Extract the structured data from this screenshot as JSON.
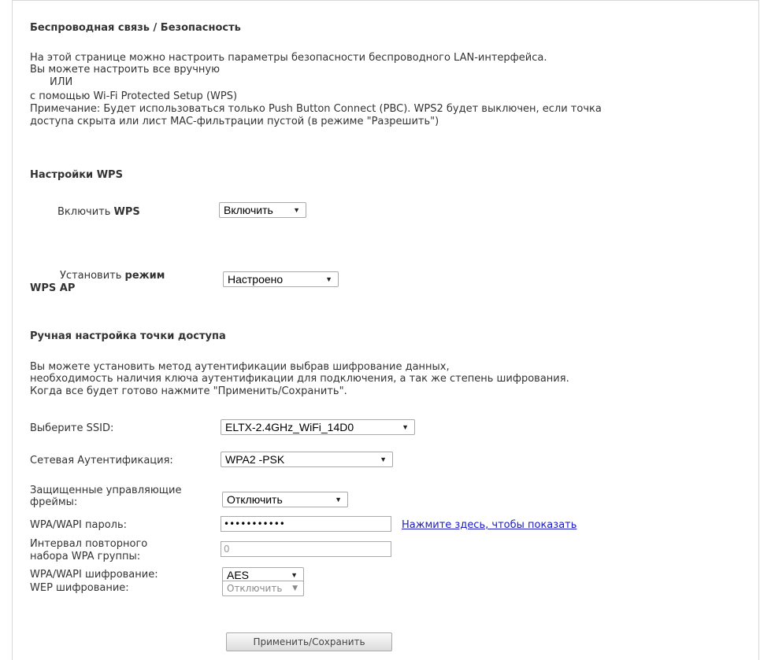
{
  "page": {
    "title": "Беспроводная связь / Безопасность",
    "intro_lines": [
      "На этой странице можно настроить параметры безопасности беспроводного LAN-интерфейса.",
      "Вы можете настроить все вручную",
      "ИЛИ",
      "с помощью Wi-Fi Protected Setup (WPS)",
      "Примечание: Будет использоваться только Push Button Connect (PBC). WPS2 будет выключен, если точка",
      "доступа скрыта или лист MAC-фильтрации пустой (в режиме \"Разрешить\")"
    ]
  },
  "wps": {
    "heading": "Настройки WPS",
    "enable_label_prefix": "Включить ",
    "enable_label_bold": "WPS",
    "enable_value": "Включить",
    "mode_label_prefix": "Установить ",
    "mode_label_bold": "режим",
    "mode_label_line2": "WPS AP",
    "mode_value": "Настроено"
  },
  "manual": {
    "heading": "Ручная настройка точки доступа",
    "desc_lines": [
      "Вы можете установить метод аутентификации выбрав шифрование данных,",
      "необходимость наличия ключа аутентификации для подключения, а так же степень шифрования.",
      "Когда все будет готово нажмите \"Применить/Сохранить\"."
    ],
    "ssid_label": "Выберите SSID:",
    "ssid_value": "ELTX-2.4GHz_WiFi_14D0",
    "auth_label": "Сетевая Аутентификация:",
    "auth_value": "WPA2 -PSK",
    "pmf_label_line1": "Защищенные управляющие",
    "pmf_label_line2": "фреймы:",
    "pmf_value": "Отключить",
    "pass_label": "WPA/WAPI пароль:",
    "pass_value": "•••••••••••",
    "show_link": "Нажмите здесь, чтобы показать",
    "rekey_label_line1": "Интервал повторного",
    "rekey_label_line2": "набора WPA группы:",
    "rekey_value": "0",
    "enc_label": "WPA/WAPI шифрование:",
    "enc_value": "AES",
    "wep_label": "WEP шифрование:",
    "wep_value": "Отключить",
    "apply_label": "Применить/Сохранить"
  },
  "icons": {
    "dropdown_arrow": "▼"
  },
  "colors": {
    "link": "#1a1ac8",
    "text": "#333333",
    "border": "#a9a9a9"
  }
}
